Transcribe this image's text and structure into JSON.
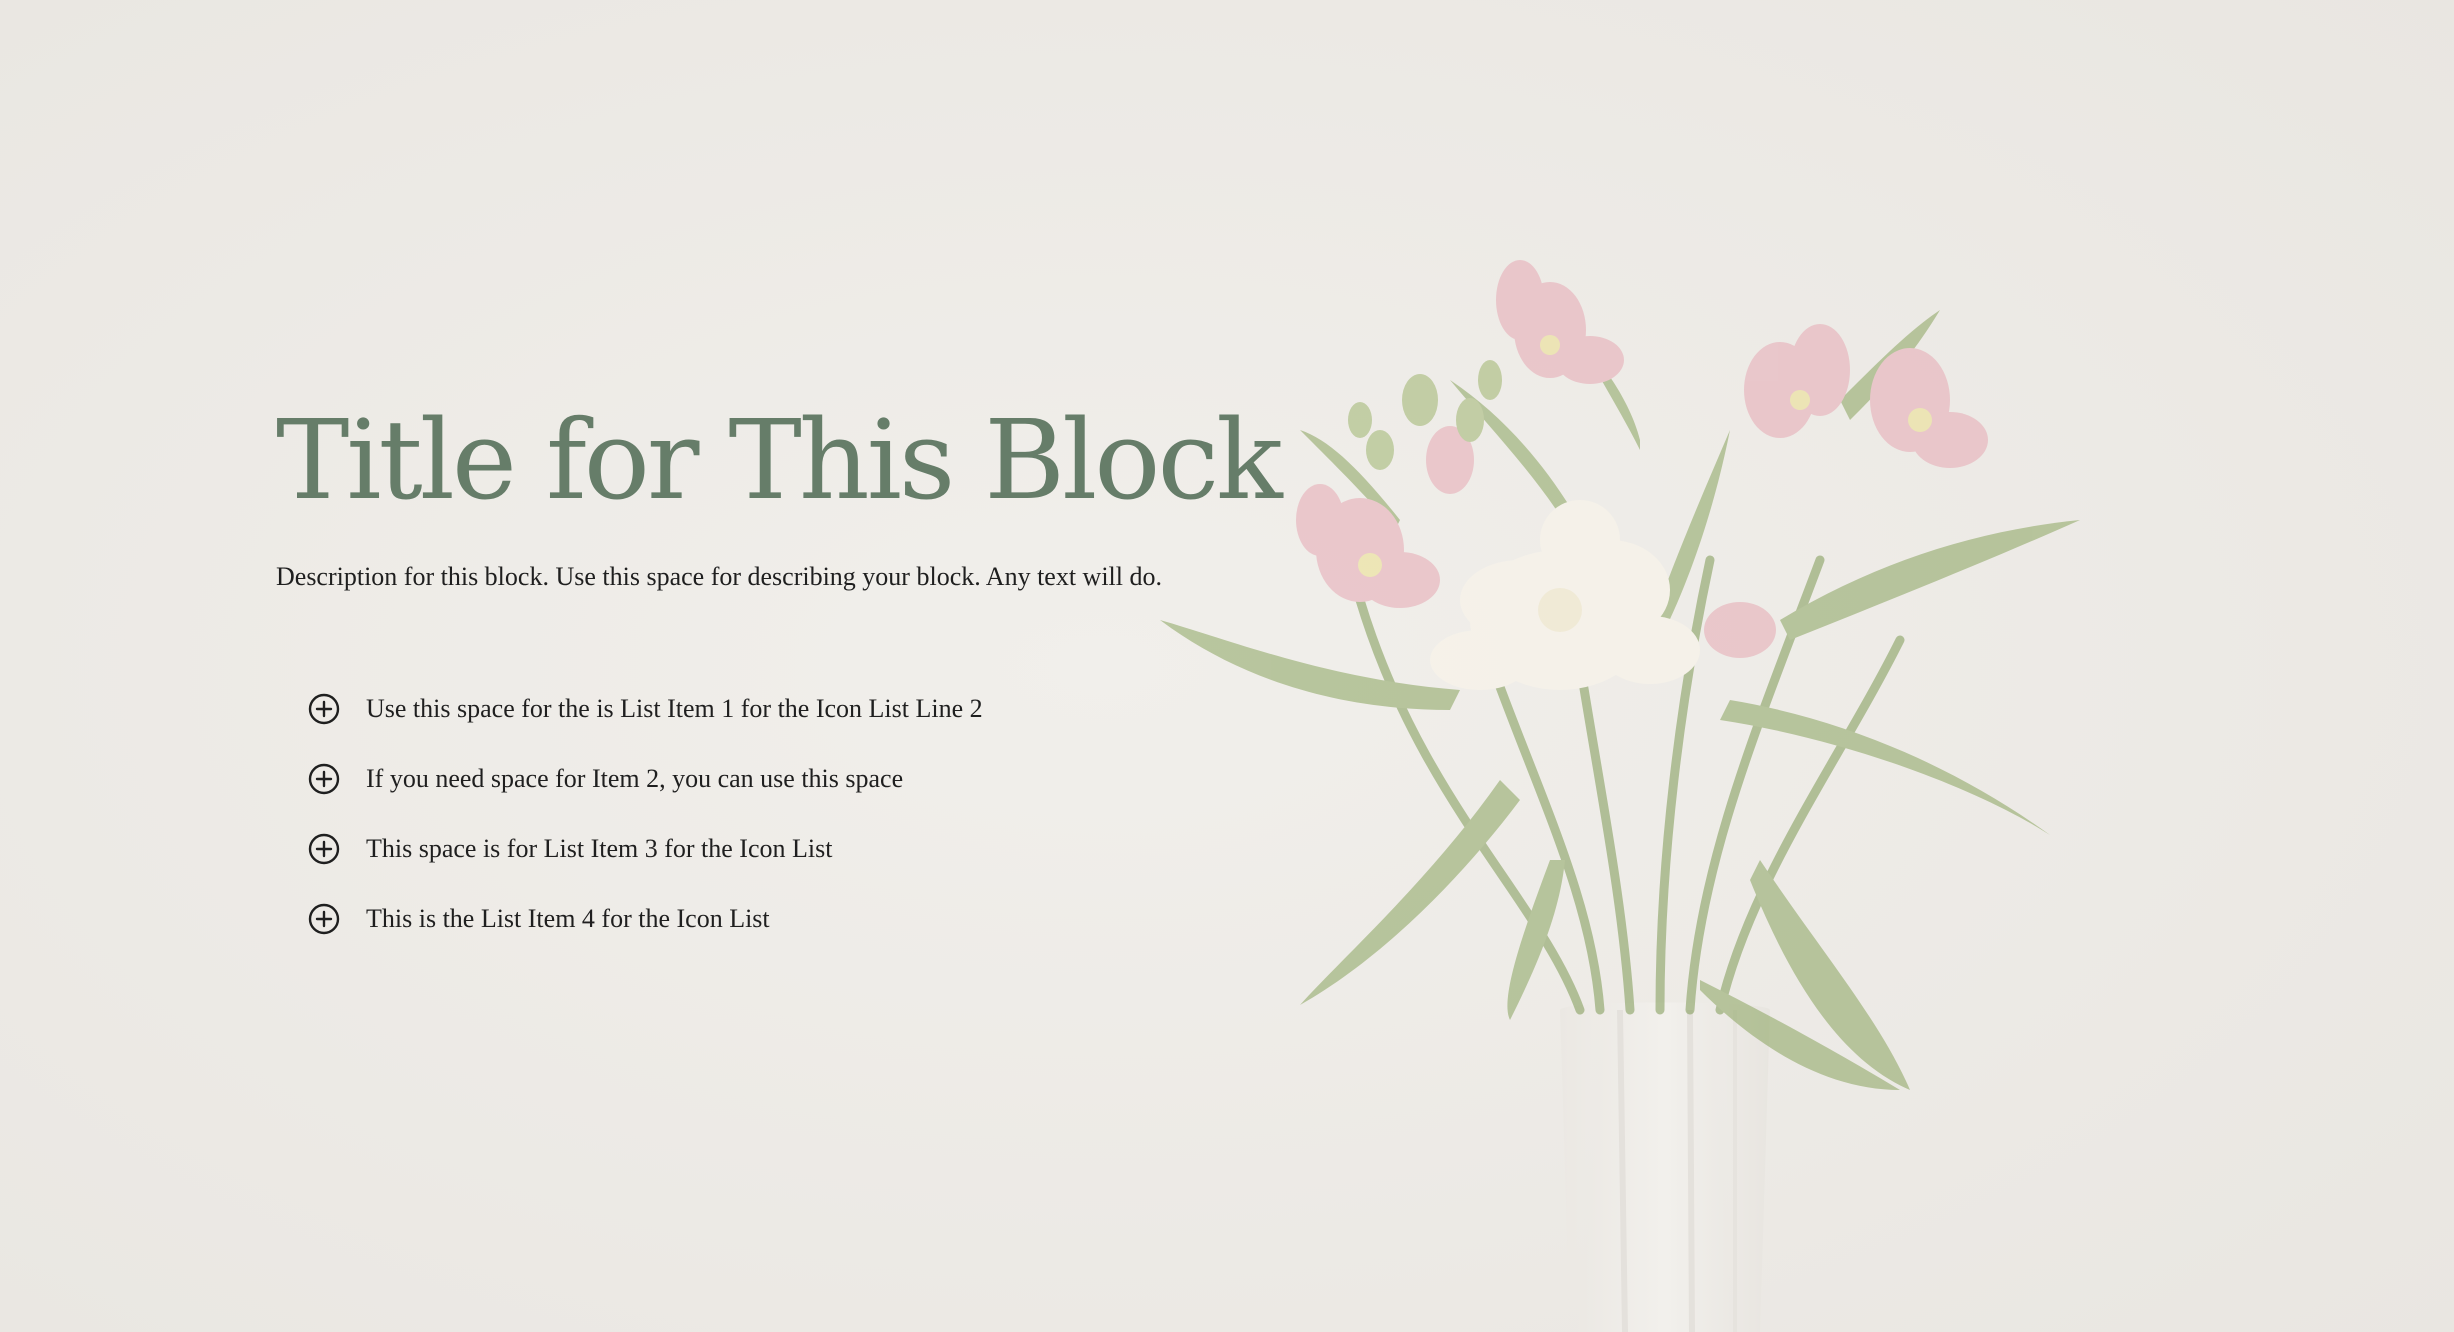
{
  "block": {
    "title": "Title for This Block",
    "description": "Description for this block. Use this space for describing your block. Any text will do.",
    "list_items": [
      {
        "icon": "plus-circle-icon",
        "label": "Use this space for the is List Item 1 for the Icon List Line 2"
      },
      {
        "icon": "plus-circle-icon",
        "label": "If you need space for Item 2, you can use this space"
      },
      {
        "icon": "plus-circle-icon",
        "label": "This space is for List Item 3 for the Icon List"
      },
      {
        "icon": "plus-circle-icon",
        "label": "This is the List Item 4 for the Icon List"
      }
    ]
  },
  "colors": {
    "background": "#efece8",
    "title": "#667d69",
    "text": "#1f1f1f",
    "leaf": "#8da36b",
    "petal_pink": "#e6b8bf",
    "petal_cream": "#f6f1e6"
  }
}
